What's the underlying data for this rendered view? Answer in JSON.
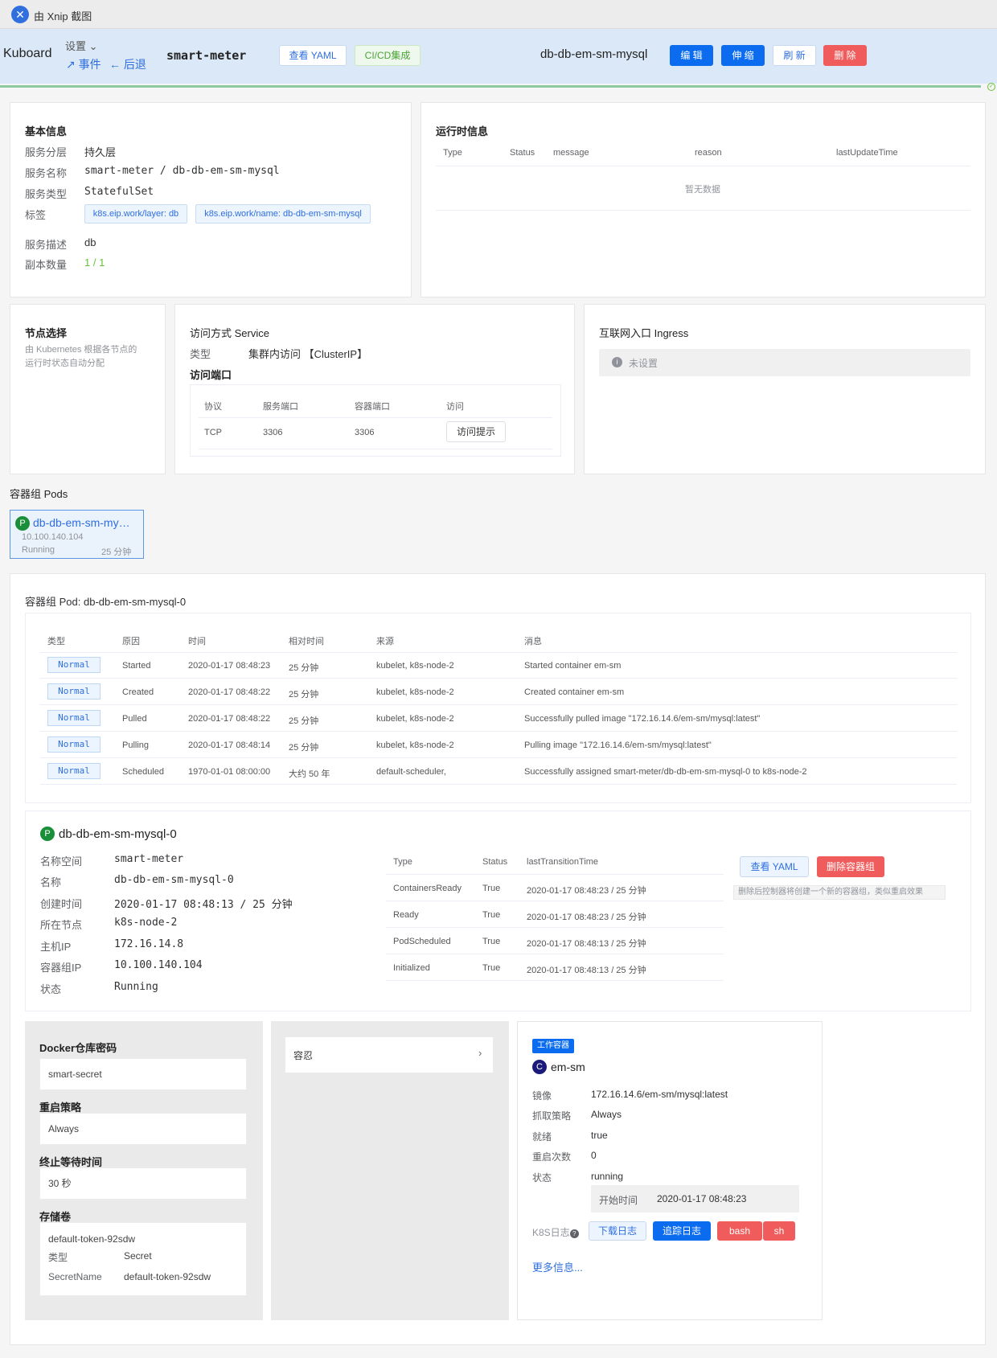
{
  "titlebar": {
    "text": "由 Xnip 截图"
  },
  "header": {
    "brand": "Kuboard",
    "settings": "设置",
    "events": "事件",
    "back": "后退",
    "namespace": "smart-meter",
    "yaml_btn": "查看 YAML",
    "cicd_btn": "CI/CD集成",
    "workload": "db-db-em-sm-mysql",
    "edit_btn": "编 辑",
    "scale_btn": "伸 缩",
    "refresh_btn": "刷 新",
    "delete_btn": "删 除"
  },
  "basic": {
    "title": "基本信息",
    "rows": [
      {
        "label": "服务分层",
        "value": "持久层"
      },
      {
        "label": "服务名称",
        "value": "smart-meter / db-db-em-sm-mysql"
      },
      {
        "label": "服务类型",
        "value": "StatefulSet"
      }
    ],
    "tags_label": "标签",
    "tags": [
      "k8s.eip.work/layer: db",
      "k8s.eip.work/name: db-db-em-sm-mysql"
    ],
    "desc_label": "服务描述",
    "desc": "db",
    "replica_label": "副本数量",
    "replica": "1 / 1"
  },
  "runtime": {
    "title": "运行时信息",
    "headers": [
      "Type",
      "Status",
      "message",
      "reason",
      "lastUpdateTime"
    ],
    "empty": "暂无数据"
  },
  "node": {
    "title": "节点选择",
    "desc1": "由 Kubernetes 根据各节点的",
    "desc2": "运行时状态自动分配"
  },
  "service": {
    "title": "访问方式 Service",
    "type_label": "类型",
    "type_value": "集群内访问 【ClusterIP】",
    "ports_title": "访问端口",
    "headers": [
      "协议",
      "服务端口",
      "容器端口",
      "访问"
    ],
    "row": {
      "protocol": "TCP",
      "port": "3306",
      "target": "3306",
      "btn": "访问提示"
    }
  },
  "ingress": {
    "title": "互联网入口 Ingress",
    "empty": "未设置"
  },
  "pods": {
    "title": "容器组 Pods",
    "name": "db-db-em-sm-my…",
    "ip": "10.100.140.104",
    "status": "Running",
    "age": "25 分钟"
  },
  "pod_detail": {
    "title_label": "容器组 Pod:",
    "title_name": "db-db-em-sm-mysql-0"
  },
  "events": {
    "headers": [
      "类型",
      "原因",
      "时间",
      "相对时间",
      "来源",
      "消息"
    ],
    "rows": [
      {
        "type": "Normal",
        "reason": "Started",
        "time": "2020-01-17 08:48:23",
        "rel": "25 分钟",
        "source": "kubelet, k8s-node-2",
        "msg": "Started container em-sm"
      },
      {
        "type": "Normal",
        "reason": "Created",
        "time": "2020-01-17 08:48:22",
        "rel": "25 分钟",
        "source": "kubelet, k8s-node-2",
        "msg": "Created container em-sm"
      },
      {
        "type": "Normal",
        "reason": "Pulled",
        "time": "2020-01-17 08:48:22",
        "rel": "25 分钟",
        "source": "kubelet, k8s-node-2",
        "msg": "Successfully pulled image \"172.16.14.6/em-sm/mysql:latest\""
      },
      {
        "type": "Normal",
        "reason": "Pulling",
        "time": "2020-01-17 08:48:14",
        "rel": "25 分钟",
        "source": "kubelet, k8s-node-2",
        "msg": "Pulling image \"172.16.14.6/em-sm/mysql:latest\""
      },
      {
        "type": "Normal",
        "reason": "Scheduled",
        "time": "1970-01-01 08:00:00",
        "rel": "大约 50 年",
        "source": "default-scheduler,",
        "msg": "Successfully assigned smart-meter/db-db-em-sm-mysql-0 to k8s-node-2"
      }
    ]
  },
  "podinfo": {
    "name": "db-db-em-sm-mysql-0",
    "rows": [
      {
        "label": "名称空间",
        "value": "smart-meter"
      },
      {
        "label": "名称",
        "value": "db-db-em-sm-mysql-0"
      },
      {
        "label": "创建时间",
        "value": "2020-01-17 08:48:13 / 25 分钟"
      },
      {
        "label": "所在节点",
        "value": "k8s-node-2"
      },
      {
        "label": "主机IP",
        "value": "172.16.14.8"
      },
      {
        "label": "容器组IP",
        "value": "10.100.140.104"
      },
      {
        "label": "状态",
        "value": "Running"
      }
    ],
    "cond_headers": [
      "Type",
      "Status",
      "lastTransitionTime"
    ],
    "conds": [
      {
        "type": "ContainersReady",
        "status": "True",
        "time": "2020-01-17 08:48:23 / 25 分钟"
      },
      {
        "type": "Ready",
        "status": "True",
        "time": "2020-01-17 08:48:23 / 25 分钟"
      },
      {
        "type": "PodScheduled",
        "status": "True",
        "time": "2020-01-17 08:48:13 / 25 分钟"
      },
      {
        "type": "Initialized",
        "status": "True",
        "time": "2020-01-17 08:48:13 / 25 分钟"
      }
    ],
    "yaml_btn": "查看 YAML",
    "delete_btn": "删除容器组",
    "delete_hint": "删除后控制器将创建一个新的容器组，类似重启效果"
  },
  "spec": {
    "secret_title": "Docker仓库密码",
    "secret": "smart-secret",
    "restart_title": "重启策略",
    "restart": "Always",
    "term_title": "终止等待时间",
    "term": "30 秒",
    "vol_title": "存储卷",
    "vol_name": "default-token-92sdw",
    "vol_type_label": "类型",
    "vol_type": "Secret",
    "vol_sn_label": "SecretName",
    "vol_sn": "default-token-92sdw"
  },
  "tolerations": {
    "title": "容忍"
  },
  "container": {
    "badge": "工作容器",
    "name": "em-sm",
    "rows": [
      {
        "label": "镜像",
        "value": "172.16.14.6/em-sm/mysql:latest"
      },
      {
        "label": "抓取策略",
        "value": "Always"
      },
      {
        "label": "就绪",
        "value": "true"
      },
      {
        "label": "重启次数",
        "value": "0"
      },
      {
        "label": "状态",
        "value": "running"
      }
    ],
    "start_label": "开始时间",
    "start_value": "2020-01-17 08:48:23",
    "logs_label": "K8S日志",
    "download": "下载日志",
    "follow": "追踪日志",
    "bash": "bash",
    "sh": "sh",
    "more": "更多信息..."
  }
}
